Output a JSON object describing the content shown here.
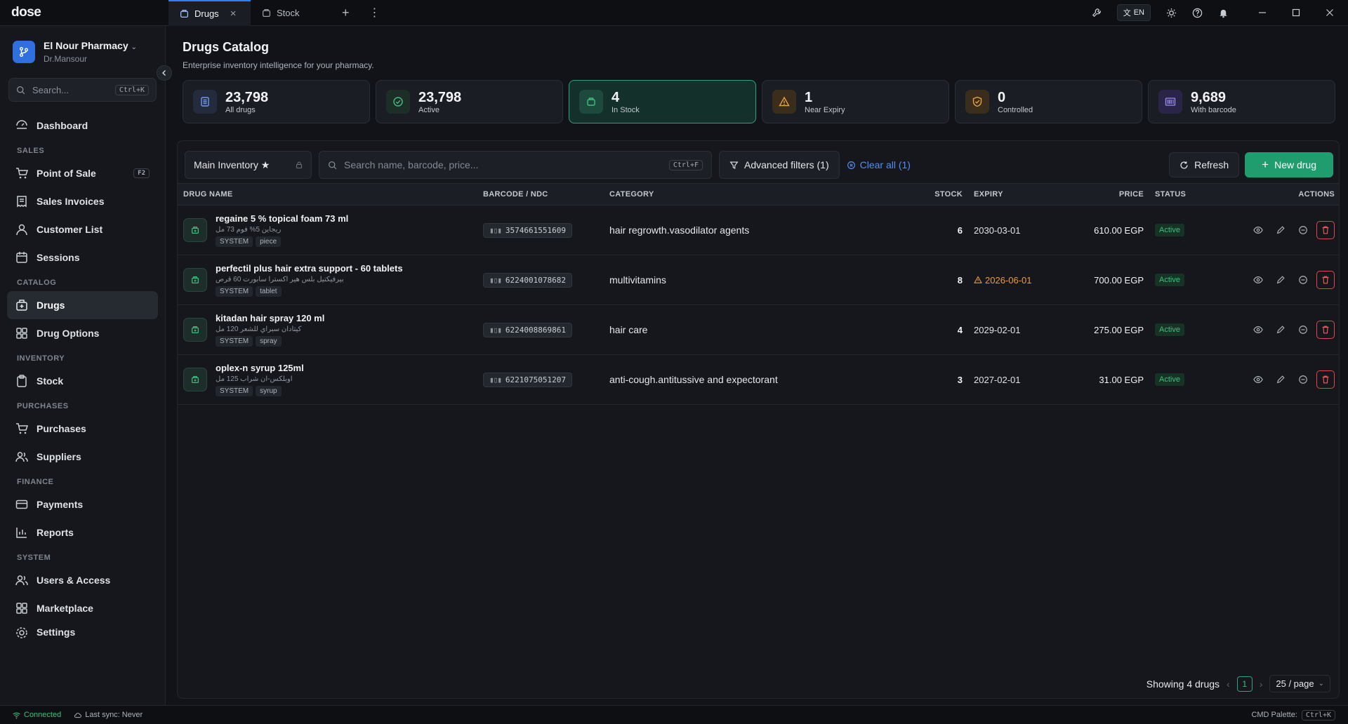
{
  "app": {
    "logo": "dose"
  },
  "tabs": [
    {
      "label": "Drugs"
    },
    {
      "label": "Stock"
    }
  ],
  "topbar": {
    "lang": "EN"
  },
  "sidebar": {
    "pharmacy_name": "El Nour Pharmacy",
    "user": "Dr.Mansour",
    "search_placeholder": "Search...",
    "search_kbd": "Ctrl+K",
    "dashboard": "Dashboard",
    "sections": {
      "sales": "SALES",
      "catalog": "CATALOG",
      "inventory": "INVENTORY",
      "purchases": "PURCHASES",
      "finance": "FINANCE",
      "system": "SYSTEM"
    },
    "items": {
      "pos": "Point of Sale",
      "pos_kbd": "F2",
      "sales_invoices": "Sales Invoices",
      "customer_list": "Customer List",
      "sessions": "Sessions",
      "drugs": "Drugs",
      "drug_options": "Drug Options",
      "stock": "Stock",
      "purchases": "Purchases",
      "suppliers": "Suppliers",
      "payments": "Payments",
      "reports": "Reports",
      "users": "Users & Access",
      "marketplace": "Marketplace",
      "settings": "Settings"
    }
  },
  "page": {
    "title": "Drugs Catalog",
    "subtitle": "Enterprise inventory intelligence for your pharmacy."
  },
  "stats": [
    {
      "value": "23,798",
      "label": "All drugs",
      "icon": "list-icon",
      "color": "#3b6fd6"
    },
    {
      "value": "23,798",
      "label": "Active",
      "icon": "check-circle-icon",
      "color": "#2ea37a"
    },
    {
      "value": "4",
      "label": "In Stock",
      "icon": "box-icon",
      "color": "#2ea37a"
    },
    {
      "value": "1",
      "label": "Near Expiry",
      "icon": "warning-icon",
      "color": "#e0982e"
    },
    {
      "value": "0",
      "label": "Controlled",
      "icon": "shield-icon",
      "color": "#e0982e"
    },
    {
      "value": "9,689",
      "label": "With barcode",
      "icon": "barcode-icon",
      "color": "#7b6cf0"
    }
  ],
  "toolbar": {
    "inventory": "Main Inventory ★",
    "search_placeholder": "Search name, barcode, price...",
    "search_kbd": "Ctrl+F",
    "advanced": "Advanced filters (1)",
    "clear": "Clear all (1)",
    "refresh": "Refresh",
    "new": "New drug"
  },
  "table": {
    "headers": {
      "name": "DRUG NAME",
      "barcode": "BARCODE / NDC",
      "category": "CATEGORY",
      "stock": "STOCK",
      "expiry": "EXPIRY",
      "price": "PRICE",
      "status": "STATUS",
      "actions": "ACTIONS"
    },
    "rows": [
      {
        "name": "regaine 5 % topical foam 73 ml",
        "arabic": "ريجاين 5% فوم 73 مل",
        "tags": [
          "SYSTEM",
          "piece"
        ],
        "barcode": "3574661551609",
        "category": "hair regrowth.vasodilator agents",
        "stock": "6",
        "expiry": "2030-03-01",
        "warn": false,
        "price": "610.00 EGP",
        "status": "Active"
      },
      {
        "name": "perfectil plus hair extra support - 60 tablets",
        "arabic": "بيرفيكتيل بلس هير اكسترا سابورت 60 قرص",
        "tags": [
          "SYSTEM",
          "tablet"
        ],
        "barcode": "6224001078682",
        "category": "multivitamins",
        "stock": "8",
        "expiry": "2026-06-01",
        "warn": true,
        "price": "700.00 EGP",
        "status": "Active"
      },
      {
        "name": "kitadan hair spray 120 ml",
        "arabic": "كيتادان سبراي للشعر 120 مل",
        "tags": [
          "SYSTEM",
          "spray"
        ],
        "barcode": "6224008869861",
        "category": "hair care",
        "stock": "4",
        "expiry": "2029-02-01",
        "warn": false,
        "price": "275.00 EGP",
        "status": "Active"
      },
      {
        "name": "oplex-n syrup 125ml",
        "arabic": "اوبلكس-ان شراب 125 مل",
        "tags": [
          "SYSTEM",
          "syrup"
        ],
        "barcode": "6221075051207",
        "category": "anti-cough.antitussive and expectorant",
        "stock": "3",
        "expiry": "2027-02-01",
        "warn": false,
        "price": "31.00 EGP",
        "status": "Active"
      }
    ]
  },
  "footer": {
    "showing": "Showing 4 drugs",
    "page": "1",
    "page_size": "25 / page"
  },
  "statusbar": {
    "connected": "Connected",
    "sync": "Last sync: Never",
    "cmd": "CMD Palette:",
    "cmd_kbd": "Ctrl+K"
  }
}
